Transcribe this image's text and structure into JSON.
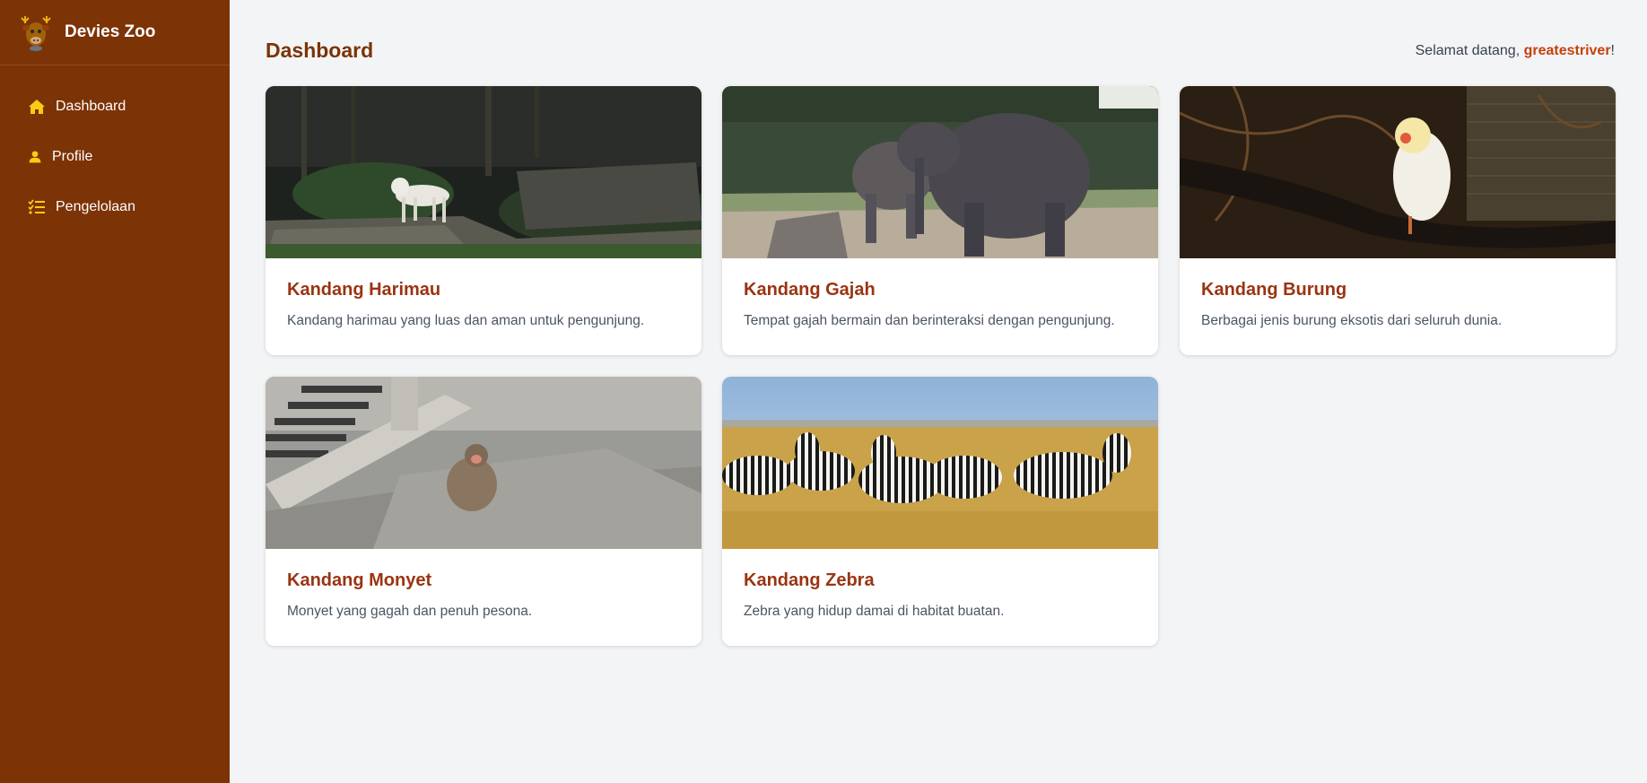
{
  "app": {
    "name": "Devies Zoo",
    "logo_icon": "moose-logo-icon"
  },
  "sidebar": {
    "items": [
      {
        "label": "Dashboard",
        "icon": "home-icon"
      },
      {
        "label": "Profile",
        "icon": "user-icon"
      },
      {
        "label": "Pengelolaan",
        "icon": "list-icon"
      }
    ]
  },
  "header": {
    "title": "Dashboard",
    "welcome_prefix": "Selamat datang, ",
    "username": "greatestriver",
    "welcome_suffix": "!"
  },
  "cards": [
    {
      "title": "Kandang Harimau",
      "desc": "Kandang harimau yang luas dan aman untuk pengunjung.",
      "image": "white tiger in forest enclosure"
    },
    {
      "title": "Kandang Gajah",
      "desc": "Tempat gajah bermain dan berinteraksi dengan pengunjung.",
      "image": "two elephants in enclosure"
    },
    {
      "title": "Kandang Burung",
      "desc": "Berbagai jenis burung eksotis dari seluruh dunia.",
      "image": "white parrot on branch"
    },
    {
      "title": "Kandang Monyet",
      "desc": "Monyet yang gagah dan penuh pesona.",
      "image": "monkey sitting on rocks"
    },
    {
      "title": "Kandang Zebra",
      "desc": "Zebra yang hidup damai di habitat buatan.",
      "image": "zebra herd in savanna"
    }
  ],
  "colors": {
    "sidebar_bg": "#7c3306",
    "accent": "#9a3412",
    "icon": "#facc15",
    "page_bg": "#f3f4f6"
  }
}
